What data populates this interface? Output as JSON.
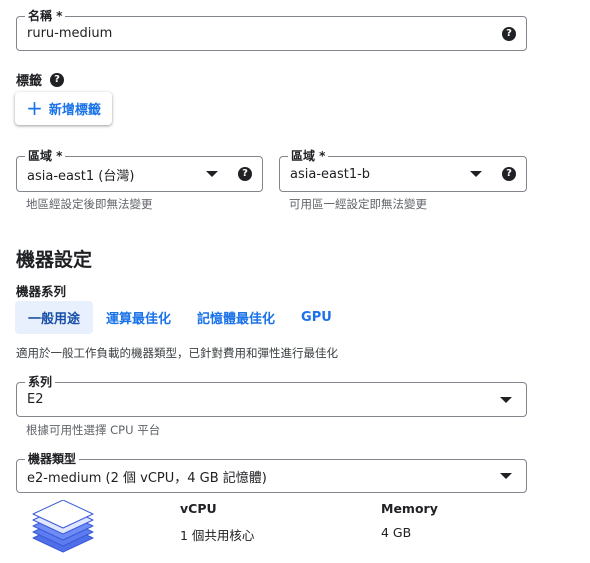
{
  "name_field": {
    "label": "名稱 *",
    "value": "ruru-medium",
    "icon": "help-icon"
  },
  "labels": {
    "heading": "標籤",
    "add_button": "新增標籤"
  },
  "region": {
    "label": "區域 *",
    "value": "asia-east1 (台灣)",
    "hint": "地區經設定後即無法變更"
  },
  "zone": {
    "label": "區域 *",
    "value": "asia-east1-b",
    "hint": "可用區一經設定即無法變更"
  },
  "machine": {
    "title": "機器設定",
    "family_label": "機器系列",
    "tabs": [
      {
        "label": "一般用途",
        "active": true
      },
      {
        "label": "運算最佳化",
        "active": false
      },
      {
        "label": "記憶體最佳化",
        "active": false
      },
      {
        "label": "GPU",
        "active": false
      }
    ],
    "description": "適用於一般工作負載的機器類型，已針對費用和彈性進行最佳化",
    "series": {
      "label": "系列",
      "value": "E2",
      "hint": "根據可用性選擇 CPU 平台"
    },
    "type": {
      "label": "機器類型",
      "value": "e2-medium (2 個 vCPU，4 GB 記憶體)"
    },
    "specs": {
      "vcpu_header": "vCPU",
      "vcpu_value": "1 個共用核心",
      "memory_header": "Memory",
      "memory_value": "4 GB"
    }
  },
  "colors": {
    "accent": "#1a73e8",
    "tab_active_bg": "#e8f0fe",
    "text": "#202124",
    "hint": "#5f6368",
    "stack_icon": "#4f6fe8"
  }
}
